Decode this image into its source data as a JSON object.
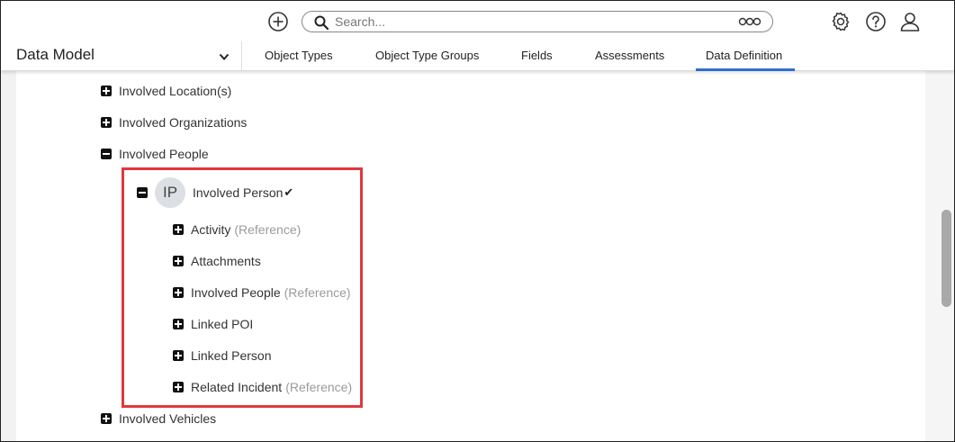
{
  "topbar": {
    "search_placeholder": "Search..."
  },
  "navbar": {
    "section_label": "Data Model",
    "tabs": [
      {
        "label": "Object Types"
      },
      {
        "label": "Object Type Groups"
      },
      {
        "label": "Fields"
      },
      {
        "label": "Assessments"
      },
      {
        "label": "Data Definition",
        "active": true
      }
    ]
  },
  "tree": {
    "top_items": [
      {
        "label": "Involved Location(s)",
        "expanded": false
      },
      {
        "label": "Involved Organizations",
        "expanded": false
      },
      {
        "label": "Involved People",
        "expanded": true
      }
    ],
    "person": {
      "avatar_initials": "IP",
      "label": "Involved Person",
      "checkmark": "✔"
    },
    "child_items": [
      {
        "label": "Activity",
        "ref": "(Reference)"
      },
      {
        "label": "Attachments",
        "ref": ""
      },
      {
        "label": "Involved People",
        "ref": "(Reference)"
      },
      {
        "label": "Linked POI",
        "ref": ""
      },
      {
        "label": "Linked Person",
        "ref": ""
      },
      {
        "label": "Related Incident",
        "ref": "(Reference)"
      }
    ],
    "bottom_item": {
      "label": "Involved Vehicles",
      "expanded": false
    }
  },
  "colors": {
    "accent": "#2f6fcc",
    "highlight_border": "#e0393e"
  }
}
